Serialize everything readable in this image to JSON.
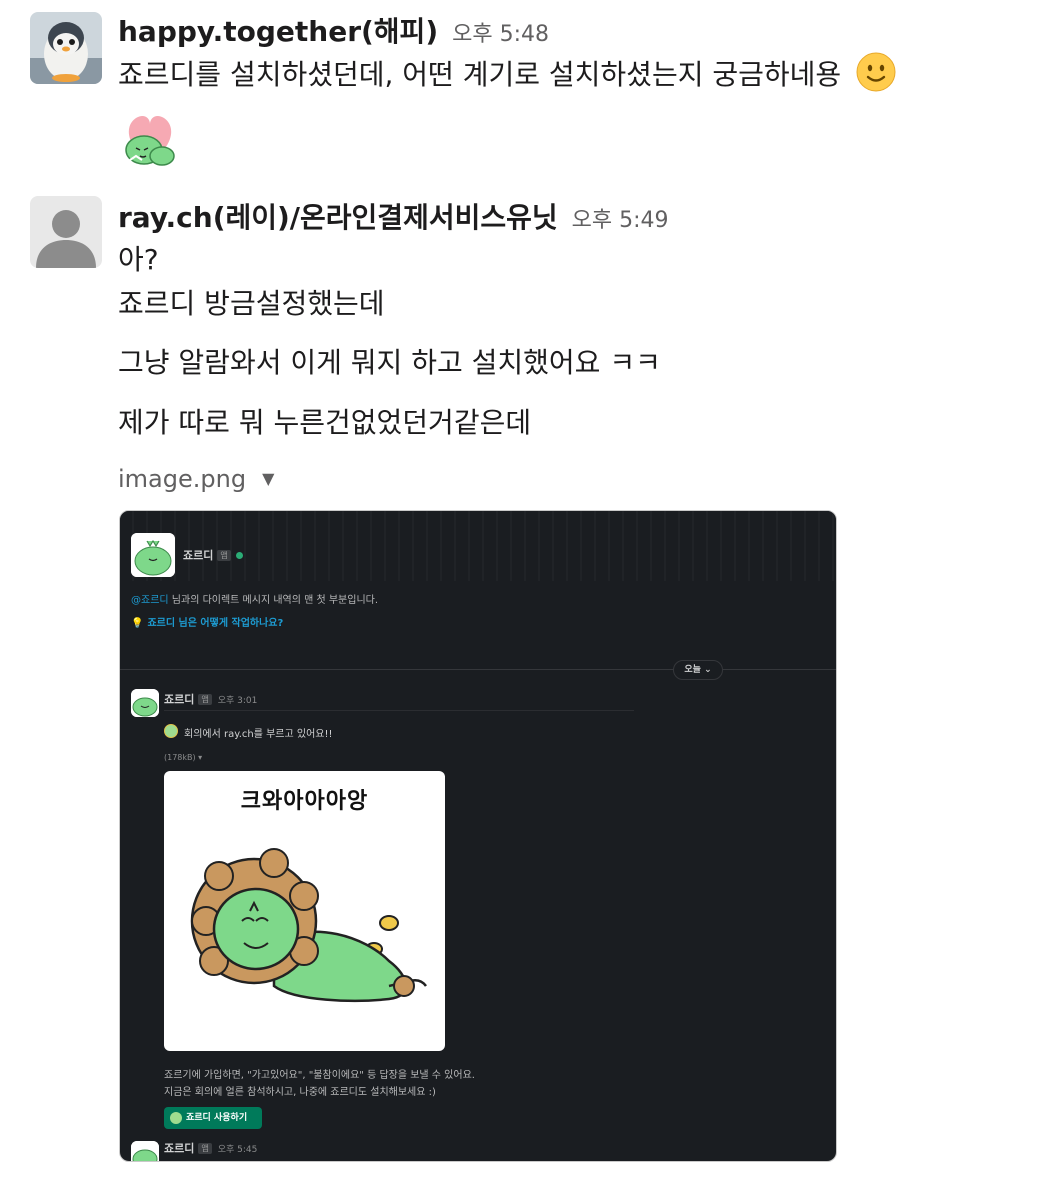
{
  "messages": [
    {
      "author": "happy.together(해피)",
      "time": "오후 5:48",
      "lines": [
        "죠르디를 설치하셨던데, 어떤 계기로 설치하셨는지 궁금하네용"
      ]
    },
    {
      "author": "ray.ch(레이)/온라인결제서비스유닛",
      "time": "오후 5:49",
      "lines": [
        "아?",
        "죠르디 방금설정했는데",
        "그냥 알람와서 이게 뭐지 하고 설치했어요 ㅋㅋ",
        "제가 따로 뭐 누른건없었던거같은데"
      ]
    }
  ],
  "attachment": {
    "filename": "image.png",
    "screenshot": {
      "header_name": "죠르디",
      "badge": "앱",
      "intro_mention": "@죠르디",
      "intro_text": " 님과의 다이렉트 메시지 내역의 맨 첫 부분입니다.",
      "intro_question": "죠르디 님은 어떻게 작업하나요?",
      "date_divider": "오늘 ⌄",
      "msg1_name": "죠르디",
      "msg1_time": "오후 3:01",
      "msg1_text": "회의에서 ray.ch를 부르고 있어요!!",
      "file_size": "(178kB) ▾",
      "card_title": "크와아아아앙",
      "desc_line1": "죠르기에 가입하면, \"가고있어요\", \"불참이에요\" 등 답장을 보낼 수 있어요.",
      "desc_line2": "지금은 회의에 얼른 참석하시고, 나중에 죠르디도 설치해보세요 :)",
      "button_label": "죠르디 사용하기",
      "msg2_name": "죠르디",
      "msg2_time": "오후 5:45"
    }
  },
  "colors": {
    "text": "#1d1c1d",
    "muted": "#616061",
    "dark_bg": "#1a1d21",
    "link": "#1d9bd1",
    "button": "#007a5a",
    "jordy_green": "#7ed88a"
  },
  "icons": [
    "penguin-avatar",
    "default-user-avatar",
    "slightly-smiling-face-emoji",
    "jordy-heart-sticker",
    "chevron-down-icon",
    "lightbulb-icon"
  ]
}
